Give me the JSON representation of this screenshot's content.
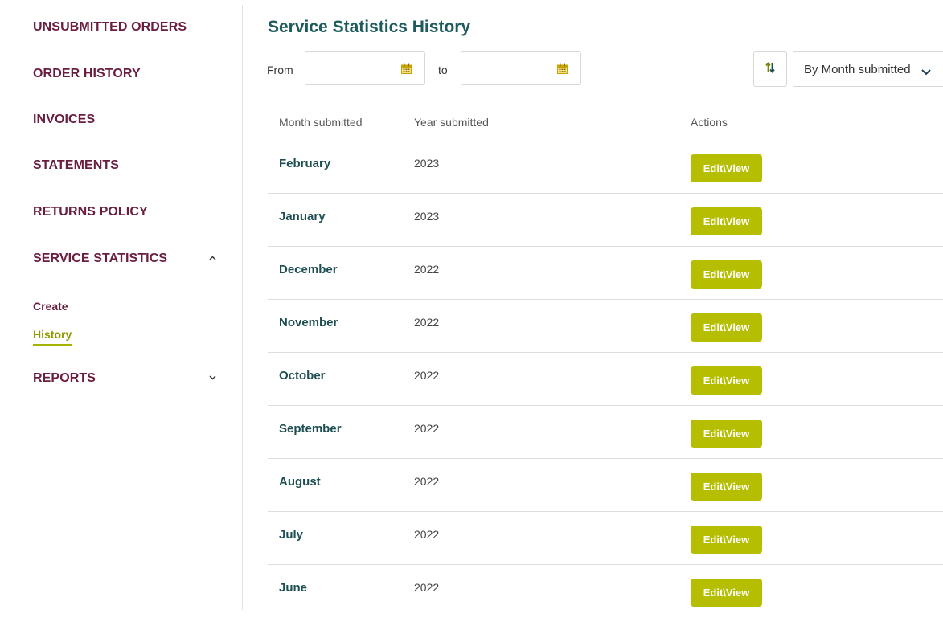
{
  "sidebar": {
    "items": [
      {
        "label": "UNSUBMITTED ORDERS"
      },
      {
        "label": "ORDER HISTORY"
      },
      {
        "label": "INVOICES"
      },
      {
        "label": "STATEMENTS"
      },
      {
        "label": "RETURNS POLICY"
      },
      {
        "label": "SERVICE STATISTICS",
        "expanded": true,
        "icon": "chevron-up-icon"
      },
      {
        "label": "REPORTS",
        "expanded": false,
        "icon": "chevron-down-icon"
      }
    ],
    "sub_items": [
      {
        "label": "Create"
      },
      {
        "label": "History",
        "active": true
      }
    ]
  },
  "main": {
    "title": "Service Statistics History",
    "filters": {
      "from_label": "From",
      "from_value": "",
      "to_label": "to",
      "to_value": "",
      "calendar_icon": "calendar-icon",
      "sort_icon": "sort-arrows-icon",
      "sort_by": "By Month submitted"
    },
    "table": {
      "columns": [
        "Month submitted",
        "Year submitted",
        "Actions"
      ],
      "action_label": "Edit\\View",
      "rows": [
        {
          "month": "February",
          "year": "2023"
        },
        {
          "month": "January",
          "year": "2023"
        },
        {
          "month": "December",
          "year": "2022"
        },
        {
          "month": "November",
          "year": "2022"
        },
        {
          "month": "October",
          "year": "2022"
        },
        {
          "month": "September",
          "year": "2022"
        },
        {
          "month": "August",
          "year": "2022"
        },
        {
          "month": "July",
          "year": "2022"
        },
        {
          "month": "June",
          "year": "2022"
        }
      ]
    }
  },
  "colors": {
    "nav_text": "#6b1d3f",
    "title": "#1d5b5e",
    "accent": "#b5be00",
    "active_sub": "#8f9a00"
  }
}
